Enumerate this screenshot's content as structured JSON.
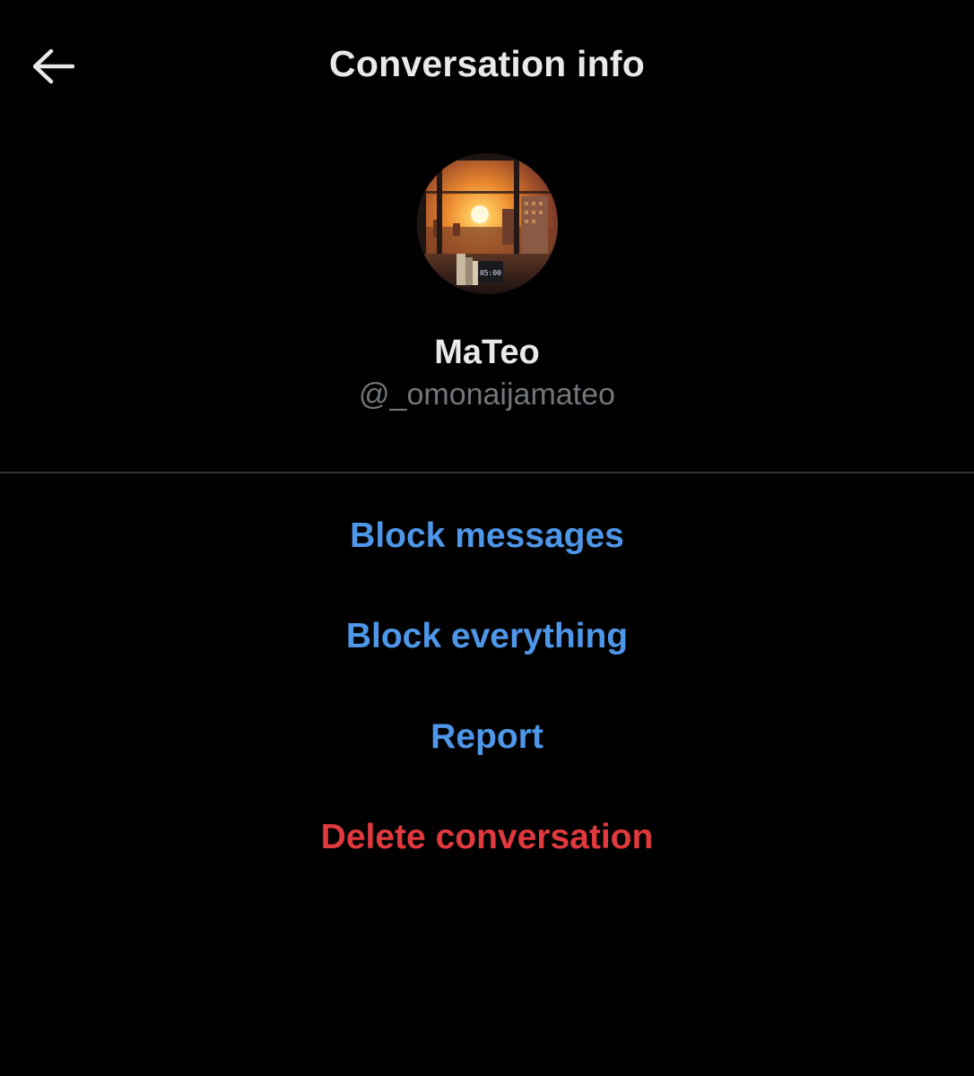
{
  "header": {
    "title": "Conversation info",
    "back_icon": "arrow-left-icon"
  },
  "profile": {
    "display_name": "MaTeo",
    "handle": "@_omonaijamateo",
    "avatar_icon": "sunset-window-avatar",
    "avatar_clock_text": "05:00"
  },
  "actions": {
    "block_messages": "Block messages",
    "block_everything": "Block everything",
    "report": "Report",
    "delete_conversation": "Delete conversation"
  },
  "colors": {
    "background": "#000000",
    "primary_text": "#e7e9ea",
    "secondary_text": "#71767b",
    "link_blue": "#4e96e8",
    "danger_red": "#e0393e",
    "divider": "#2f3336"
  }
}
